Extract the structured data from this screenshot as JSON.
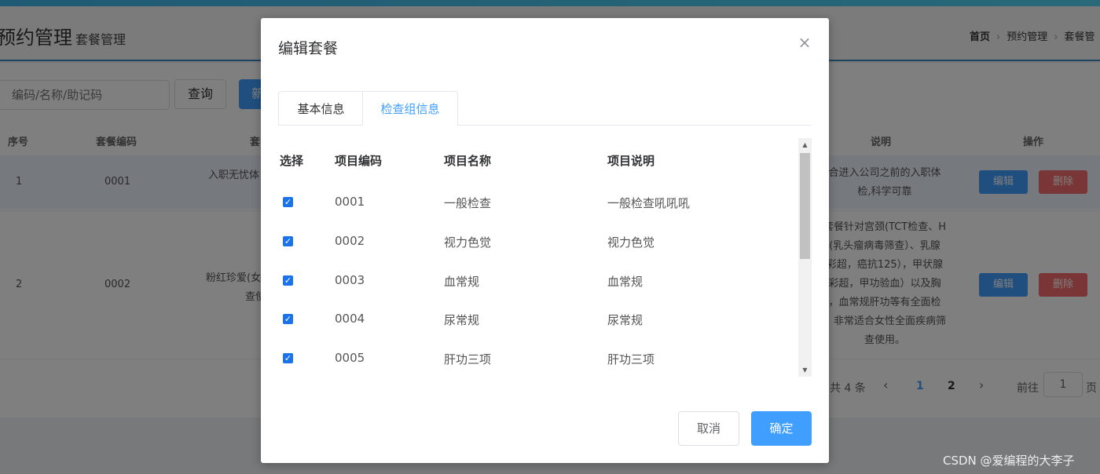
{
  "page": {
    "title": "预约管理",
    "subtitle": "套餐管理",
    "breadcrumb": [
      "首页",
      "预约管理",
      "套餐管"
    ],
    "search_placeholder": "编码/名称/助记码",
    "query_label": "查询",
    "new_label": "新",
    "columns": [
      "序号",
      "套餐编码",
      "套",
      "说明",
      "操作"
    ],
    "rows": [
      {
        "index": "1",
        "code": "0001",
        "name": "入职无忧体",
        "desc": [
          "合进入公司之前的入职体",
          "检,科学可靠"
        ]
      },
      {
        "index": "2",
        "code": "0002",
        "name": "粉红珍爱(女",
        "name2": "查使",
        "desc": [
          "套餐针对宫颈(TCT检查、H",
          "(乳头瘤病毒筛查）、乳腺",
          "彩超，癌抗125），甲状腺",
          "彩超，甲功验血）以及胸",
          "，血常规肝功等有全面检",
          "。非常适合女性全面疾病筛",
          "查使用。"
        ]
      }
    ],
    "edit_label": "编辑",
    "delete_label": "删除",
    "pager": {
      "total": "共 4 条",
      "prev": "‹",
      "pages": [
        "1",
        "2"
      ],
      "next": "›",
      "goto": "前往",
      "goto_value": "1",
      "page_unit": "页"
    }
  },
  "dialog": {
    "title": "编辑套餐",
    "close_icon": "close-icon",
    "tabs": [
      "基本信息",
      "检查组信息"
    ],
    "active_tab": "检查组信息",
    "table": {
      "headers": [
        "选择",
        "项目编码",
        "项目名称",
        "项目说明"
      ],
      "rows": [
        {
          "checked": true,
          "code": "0001",
          "name": "一般检查",
          "desc": "一般检查吼吼吼"
        },
        {
          "checked": true,
          "code": "0002",
          "name": "视力色觉",
          "desc": "视力色觉"
        },
        {
          "checked": true,
          "code": "0003",
          "name": "血常规",
          "desc": "血常规"
        },
        {
          "checked": true,
          "code": "0004",
          "name": "尿常规",
          "desc": "尿常规"
        },
        {
          "checked": true,
          "code": "0005",
          "name": "肝功三项",
          "desc": "肝功三项"
        }
      ]
    },
    "cancel_label": "取消",
    "confirm_label": "确定"
  },
  "watermark": "CSDN @爱编程的大李子",
  "colors": {
    "primary": "#409eff",
    "danger": "#f56c6c",
    "overlay": "rgba(0,0,0,0.5)"
  }
}
